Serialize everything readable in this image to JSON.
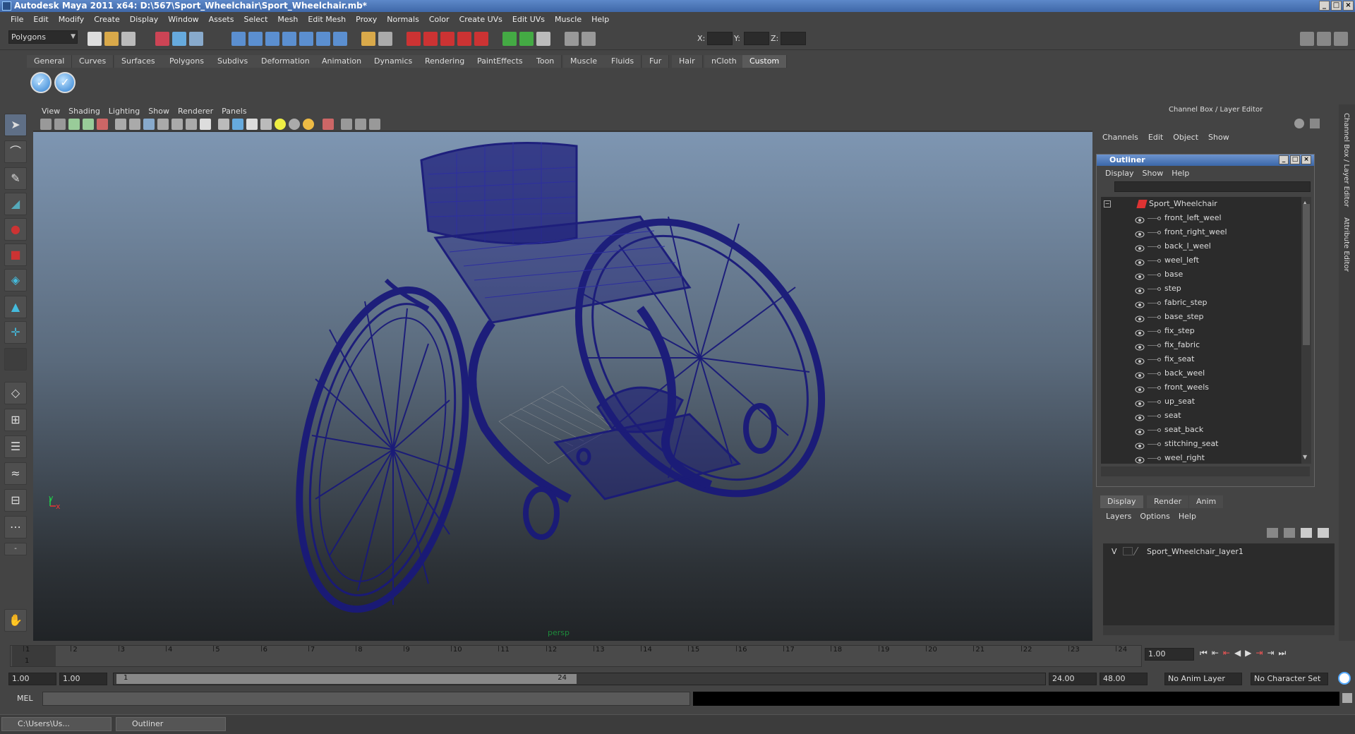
{
  "window": {
    "title": "Autodesk Maya 2011 x64: D:\\567\\Sport_Wheelchair\\Sport_Wheelchair.mb*"
  },
  "menubar": [
    "File",
    "Edit",
    "Modify",
    "Create",
    "Display",
    "Window",
    "Assets",
    "Select",
    "Mesh",
    "Edit Mesh",
    "Proxy",
    "Normals",
    "Color",
    "Create UVs",
    "Edit UVs",
    "Muscle",
    "Help"
  ],
  "statusline": {
    "mode_select": "Polygons",
    "x_label": "X:",
    "y_label": "Y:",
    "z_label": "Z:"
  },
  "shelf": {
    "tabs": [
      "General",
      "Curves",
      "Surfaces",
      "Polygons",
      "Subdivs",
      "Deformation",
      "Animation",
      "Dynamics",
      "Rendering",
      "PaintEffects",
      "Toon",
      "Muscle",
      "Fluids",
      "Fur",
      "Hair",
      "nCloth",
      "Custom"
    ],
    "active_tab": "Custom"
  },
  "viewport": {
    "menu": [
      "View",
      "Shading",
      "Lighting",
      "Show",
      "Renderer",
      "Panels"
    ],
    "camera_label": "persp",
    "axis_y": "y",
    "axis_x": "x"
  },
  "channelbox": {
    "title": "Channel Box / Layer Editor",
    "menu": [
      "Channels",
      "Edit",
      "Object",
      "Show"
    ]
  },
  "sidetabs": [
    "Channel Box / Layer Editor",
    "Attribute Editor"
  ],
  "outliner": {
    "title": "Outliner",
    "menu": [
      "Display",
      "Show",
      "Help"
    ],
    "root": "Sport_Wheelchair",
    "items": [
      "front_left_weel",
      "front_right_weel",
      "back_l_weel",
      "weel_left",
      "base",
      "step",
      "fabric_step",
      "base_step",
      "fix_step",
      "fix_fabric",
      "fix_seat",
      "back_weel",
      "front_weels",
      "up_seat",
      "seat",
      "seat_back",
      "stitching_seat",
      "weel_right"
    ]
  },
  "layers": {
    "tabs": [
      "Display",
      "Render",
      "Anim"
    ],
    "active_tab": "Display",
    "menu": [
      "Layers",
      "Options",
      "Help"
    ],
    "rows": [
      {
        "visible": "V",
        "name": "Sport_Wheelchair_layer1"
      }
    ]
  },
  "timeline": {
    "ticks": [
      "1",
      "2",
      "3",
      "4",
      "5",
      "6",
      "7",
      "8",
      "9",
      "10",
      "11",
      "12",
      "13",
      "14",
      "15",
      "16",
      "17",
      "18",
      "19",
      "20",
      "21",
      "22",
      "23",
      "24"
    ],
    "current_frame": "1.00",
    "current_marker": "1"
  },
  "range": {
    "start": "1.00",
    "playback_start": "1.00",
    "slider_start": "1",
    "slider_end": "24",
    "playback_end": "24.00",
    "end": "48.00",
    "anim_layer": "No Anim Layer",
    "character_set": "No Character Set"
  },
  "commandline": {
    "label": "MEL"
  },
  "taskbar": [
    {
      "label": "C:\\Users\\Us..."
    },
    {
      "label": "Outliner"
    }
  ],
  "colors": {
    "wireframe": "#1a1a7a",
    "viewport_top": "#7e96b2",
    "viewport_bottom": "#202326",
    "title_blue": "#3f68a8"
  }
}
